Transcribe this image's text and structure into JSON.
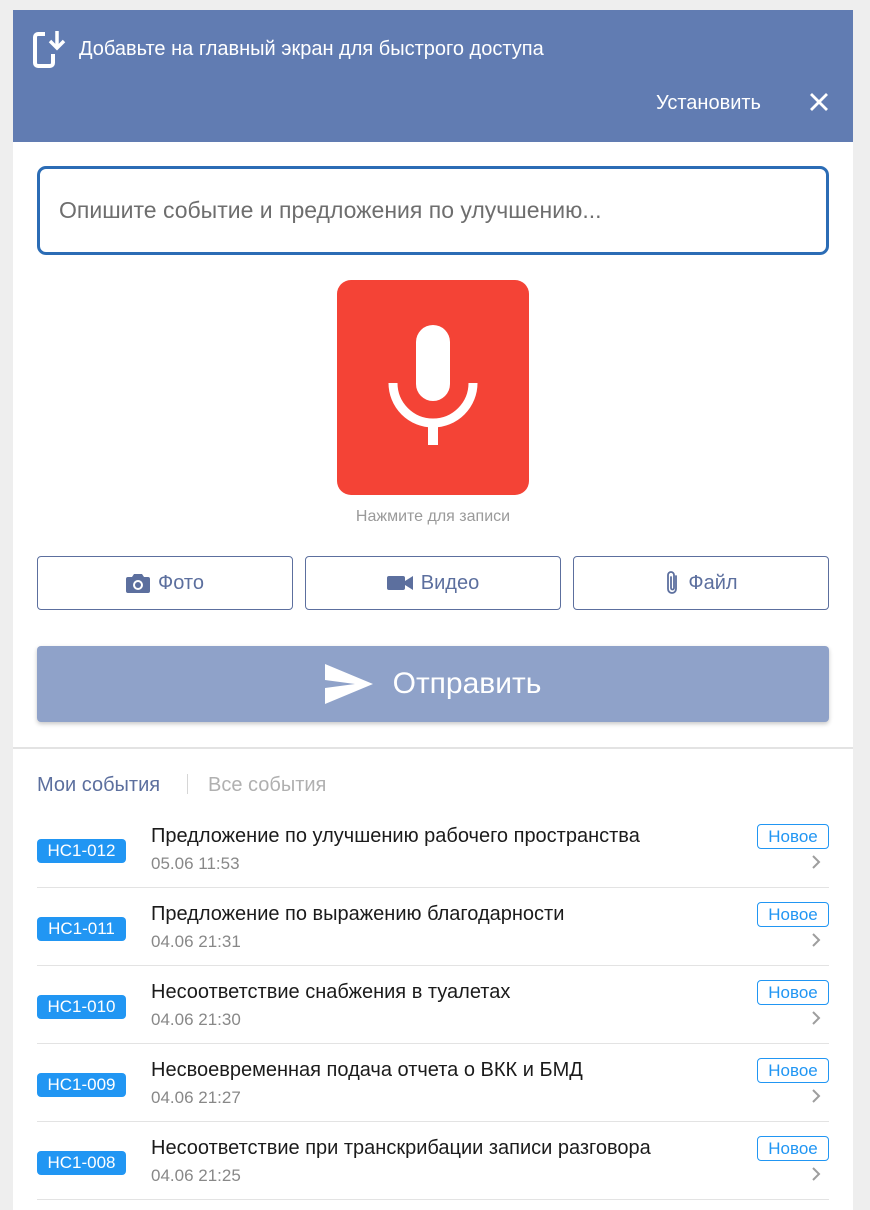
{
  "banner": {
    "text": "Добавьте на главный экран для быстрого доступа",
    "install_label": "Установить",
    "icon": "add-to-home-icon",
    "background": "#617cb2"
  },
  "form": {
    "placeholder": "Опишите событие и предложения по улучшению...",
    "value": "",
    "mic_hint": "Нажмите для записи",
    "mic_color": "#f44336",
    "photo_label": "Фото",
    "video_label": "Видео",
    "file_label": "Файл",
    "send_label": "Отправить"
  },
  "tabs": {
    "my": "Мои события",
    "all": "Все события",
    "active": "my"
  },
  "events": [
    {
      "code": "НС1-012",
      "title": "Предложение по улучшению рабочего пространства",
      "date": "05.06 11:53",
      "status": "Новое"
    },
    {
      "code": "НС1-011",
      "title": "Предложение по выражению благодарности",
      "date": "04.06 21:31",
      "status": "Новое"
    },
    {
      "code": "НС1-010",
      "title": "Несоответствие снабжения в туалетах",
      "date": "04.06 21:30",
      "status": "Новое"
    },
    {
      "code": "НС1-009",
      "title": "Несвоевременная подача отчета о ВКК и БМД",
      "date": "04.06 21:27",
      "status": "Новое"
    },
    {
      "code": "НС1-008",
      "title": "Несоответствие при транскрибации записи разговора",
      "date": "04.06 21:25",
      "status": "Новое"
    }
  ]
}
